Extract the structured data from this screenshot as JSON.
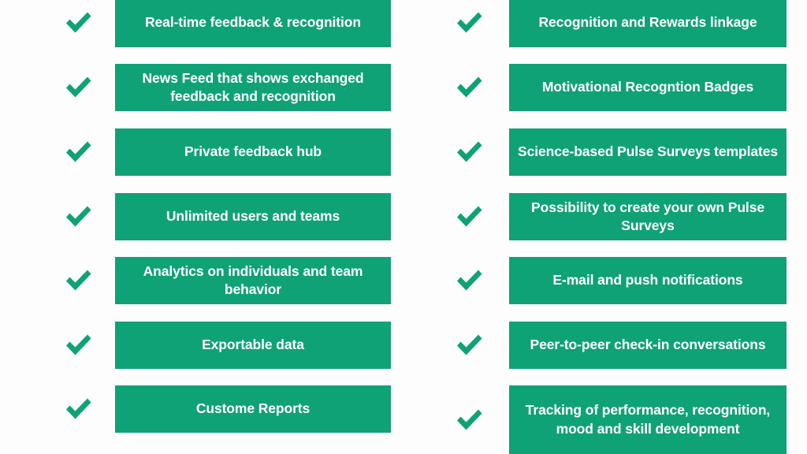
{
  "theme": {
    "accent_green": "#0fa276",
    "background": "#fdfdfd",
    "text_on_accent": "#ffffff",
    "check_icon_name": "check-icon"
  },
  "layout": {
    "columns": 2,
    "rows_per_column": 7,
    "total_features": 14
  },
  "columns": {
    "left": {
      "name": "left-feature-column",
      "items": [
        {
          "label": "Real-time feedback & recognition",
          "lines": 1
        },
        {
          "label": "News Feed that shows exchanged feedback and recognition",
          "lines": 2
        },
        {
          "label": "Private feedback hub",
          "lines": 1
        },
        {
          "label": "Unlimited users and teams",
          "lines": 1
        },
        {
          "label": "Analytics on individuals and team behavior",
          "lines": 2
        },
        {
          "label": "Exportable data",
          "lines": 1
        },
        {
          "label": "Custome Reports",
          "lines": 1
        }
      ]
    },
    "right": {
      "name": "right-feature-column",
      "items": [
        {
          "label": "Recognition and Rewards linkage",
          "lines": 1
        },
        {
          "label": "Motivational Recogntion Badges",
          "lines": 1
        },
        {
          "label": "Science-based Pulse Surveys templates",
          "lines": 2
        },
        {
          "label": "Possibility to create your own Pulse Surveys",
          "lines": 2
        },
        {
          "label": "E-mail and push notifications",
          "lines": 1
        },
        {
          "label": "Peer-to-peer check-in conversations",
          "lines": 2
        },
        {
          "label": "Tracking of performance, recognition, mood and skill development",
          "lines": 3
        }
      ]
    }
  }
}
